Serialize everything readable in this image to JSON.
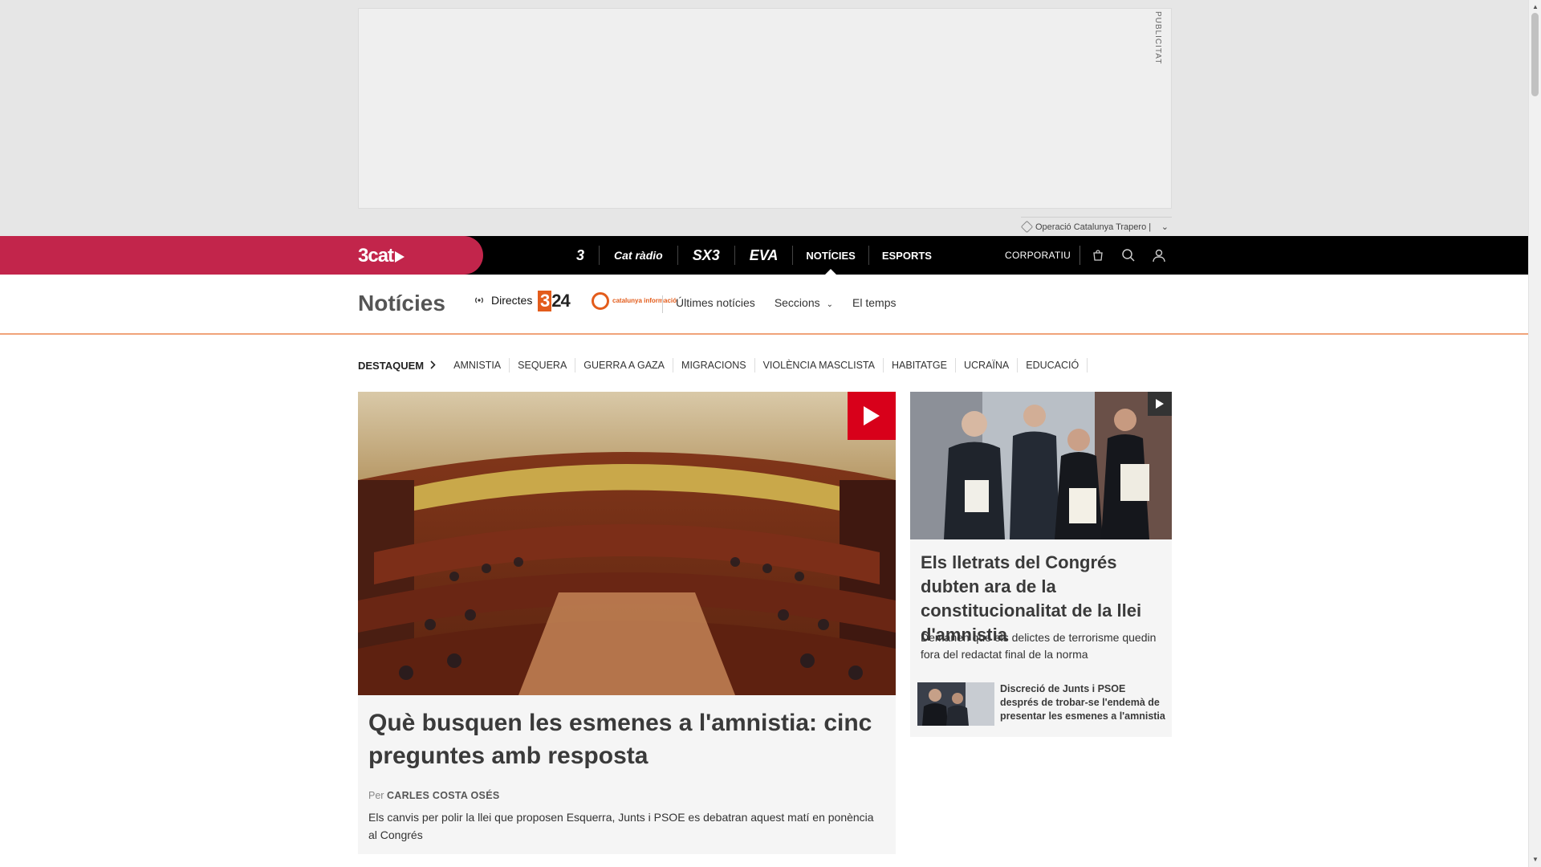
{
  "ad": {
    "label": "PUBLICITAT",
    "sponsor_text": "Operació Catalunya Trapero |"
  },
  "topnav": {
    "brand": "3cat",
    "channels": [
      "3",
      "Cat ràdio",
      "SX3",
      "EVA"
    ],
    "items": [
      {
        "label": "NOTÍCIES",
        "active": true
      },
      {
        "label": "ESPORTS",
        "active": false
      }
    ],
    "corporate": "CORPORATIU"
  },
  "section": {
    "title": "Notícies",
    "directes": "Directes",
    "logo_324_a": "3",
    "logo_324_b": "24",
    "logo_ci": "catalunya informació",
    "links": {
      "latest": "Últimes notícies",
      "sections": "Seccions",
      "weather": "El temps"
    }
  },
  "tags": {
    "label": "DESTAQUEM",
    "items": [
      "AMNISTIA",
      "SEQUERA",
      "GUERRA A GAZA",
      "MIGRACIONS",
      "VIOLÈNCIA MASCLISTA",
      "HABITATGE",
      "UCRAÏNA",
      "EDUCACIÓ"
    ]
  },
  "main_article": {
    "title": "Què busquen les esmenes a l'amnistia: cinc preguntes amb resposta",
    "by_prefix": "Per",
    "author": "CARLES COSTA OSÉS",
    "description": "Els canvis per polir la llei que proposen Esquerra, Junts i PSOE es debatran aquest matí en ponència al Congrés"
  },
  "side_article": {
    "title": "Els lletrats del Congrés dubten ara de la constitucionalitat de la llei d'amnistia",
    "description": "Demanen que els delictes de terrorisme quedin fora del redactat final de la norma",
    "related_title": "Discreció de Junts i PSOE després de trobar-se l'endemà de presentar les esmenes a l'amnistia"
  },
  "colors": {
    "brand": "#c2254b",
    "accent_orange": "#e35c1b",
    "play_red": "#d8001a"
  }
}
